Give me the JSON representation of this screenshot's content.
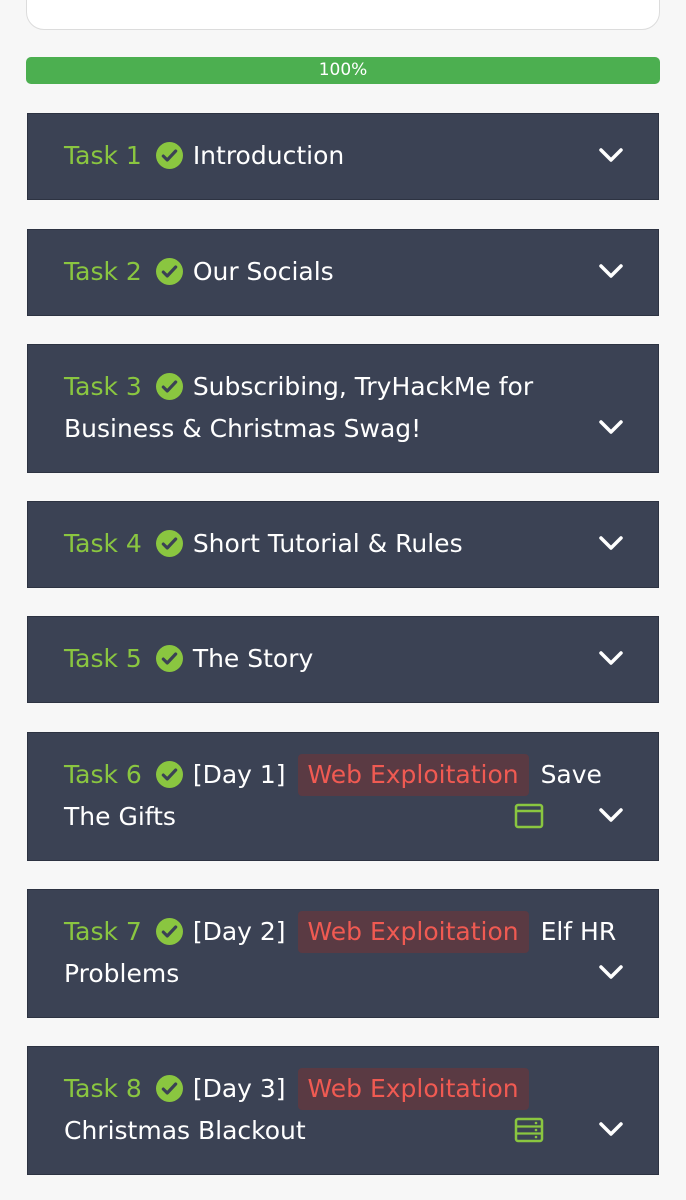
{
  "progress": {
    "label": "100%",
    "value": 1.0
  },
  "colors": {
    "task_bg": "#3b4254",
    "task_number": "#8ac640",
    "check": "#8ac640",
    "tag_text": "#f05a52",
    "tag_bg": "#5a3a43",
    "progress_fill": "#4caf50"
  },
  "tasks": [
    {
      "number": "Task 1",
      "title": "Introduction",
      "status_icon": "check-circle-icon"
    },
    {
      "number": "Task 2",
      "title": "Our Socials",
      "status_icon": "check-circle-icon"
    },
    {
      "number": "Task 3",
      "title_line1": "Subscribing, TryHackMe for",
      "title_line2": "Business & Christmas Swag!",
      "status_icon": "check-circle-icon"
    },
    {
      "number": "Task 4",
      "title": "Short Tutorial & Rules",
      "status_icon": "check-circle-icon"
    },
    {
      "number": "Task 5",
      "title": "The Story",
      "status_icon": "check-circle-icon"
    },
    {
      "number": "Task 6",
      "day": "[Day 1]",
      "tag": "Web Exploitation",
      "title_tail": "Save",
      "title_line2": "The Gifts",
      "type_icon": "browser-window-icon"
    },
    {
      "number": "Task 7",
      "day": "[Day 2]",
      "tag": "Web Exploitation",
      "title_tail": "Elf HR",
      "title_line2": "Problems"
    },
    {
      "number": "Task 8",
      "day": "[Day 3]",
      "tag": "Web Exploitation",
      "title_line2": "Christmas Blackout",
      "type_icon": "server-icon"
    }
  ]
}
